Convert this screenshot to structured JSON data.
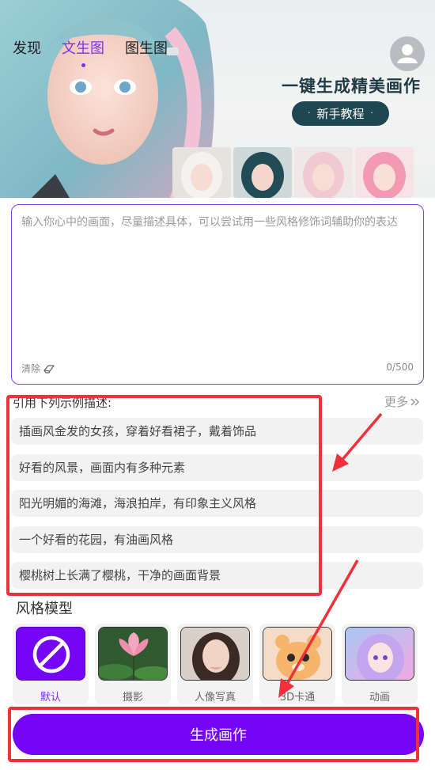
{
  "header": {
    "tabs": [
      {
        "label": "发现"
      },
      {
        "label": "文生图"
      },
      {
        "label": "图生图"
      }
    ],
    "active_tab": "文生图",
    "slogan": "一键生成精美画作",
    "tutorial_button": "新手教程",
    "tutorial_dots": "·"
  },
  "prompt": {
    "placeholder": "输入你心中的画面，尽量描述具体，可以尝试用一些风格修饰词辅助你的表达",
    "value": "",
    "clear_label": "清除",
    "counter": "0/500"
  },
  "examples": {
    "title": "引用下列示例描述:",
    "more_label": "更多",
    "items": [
      "插画风金发的女孩，穿着好看裙子，戴着饰品",
      "好看的风景，画面内有多种元素",
      "阳光明媚的海滩，海浪拍岸，有印象主义风格",
      "一个好看的花园，有油画风格",
      "樱桃树上长满了樱桃，干净的画面背景"
    ]
  },
  "styles": {
    "title": "风格模型",
    "items": [
      {
        "label": "默认",
        "icon": "ban-icon"
      },
      {
        "label": "摄影",
        "icon": "lotus-photo"
      },
      {
        "label": "人像写真",
        "icon": "portrait-photo"
      },
      {
        "label": "3D卡通",
        "icon": "cartoon-hamster"
      },
      {
        "label": "动画",
        "icon": "anime-girl"
      }
    ],
    "selected": "默认"
  },
  "generate_button": "生成画作",
  "colors": {
    "accent": "#7405f7",
    "active_tab": "#7b2ff2",
    "annotation_red": "#f0303a"
  }
}
